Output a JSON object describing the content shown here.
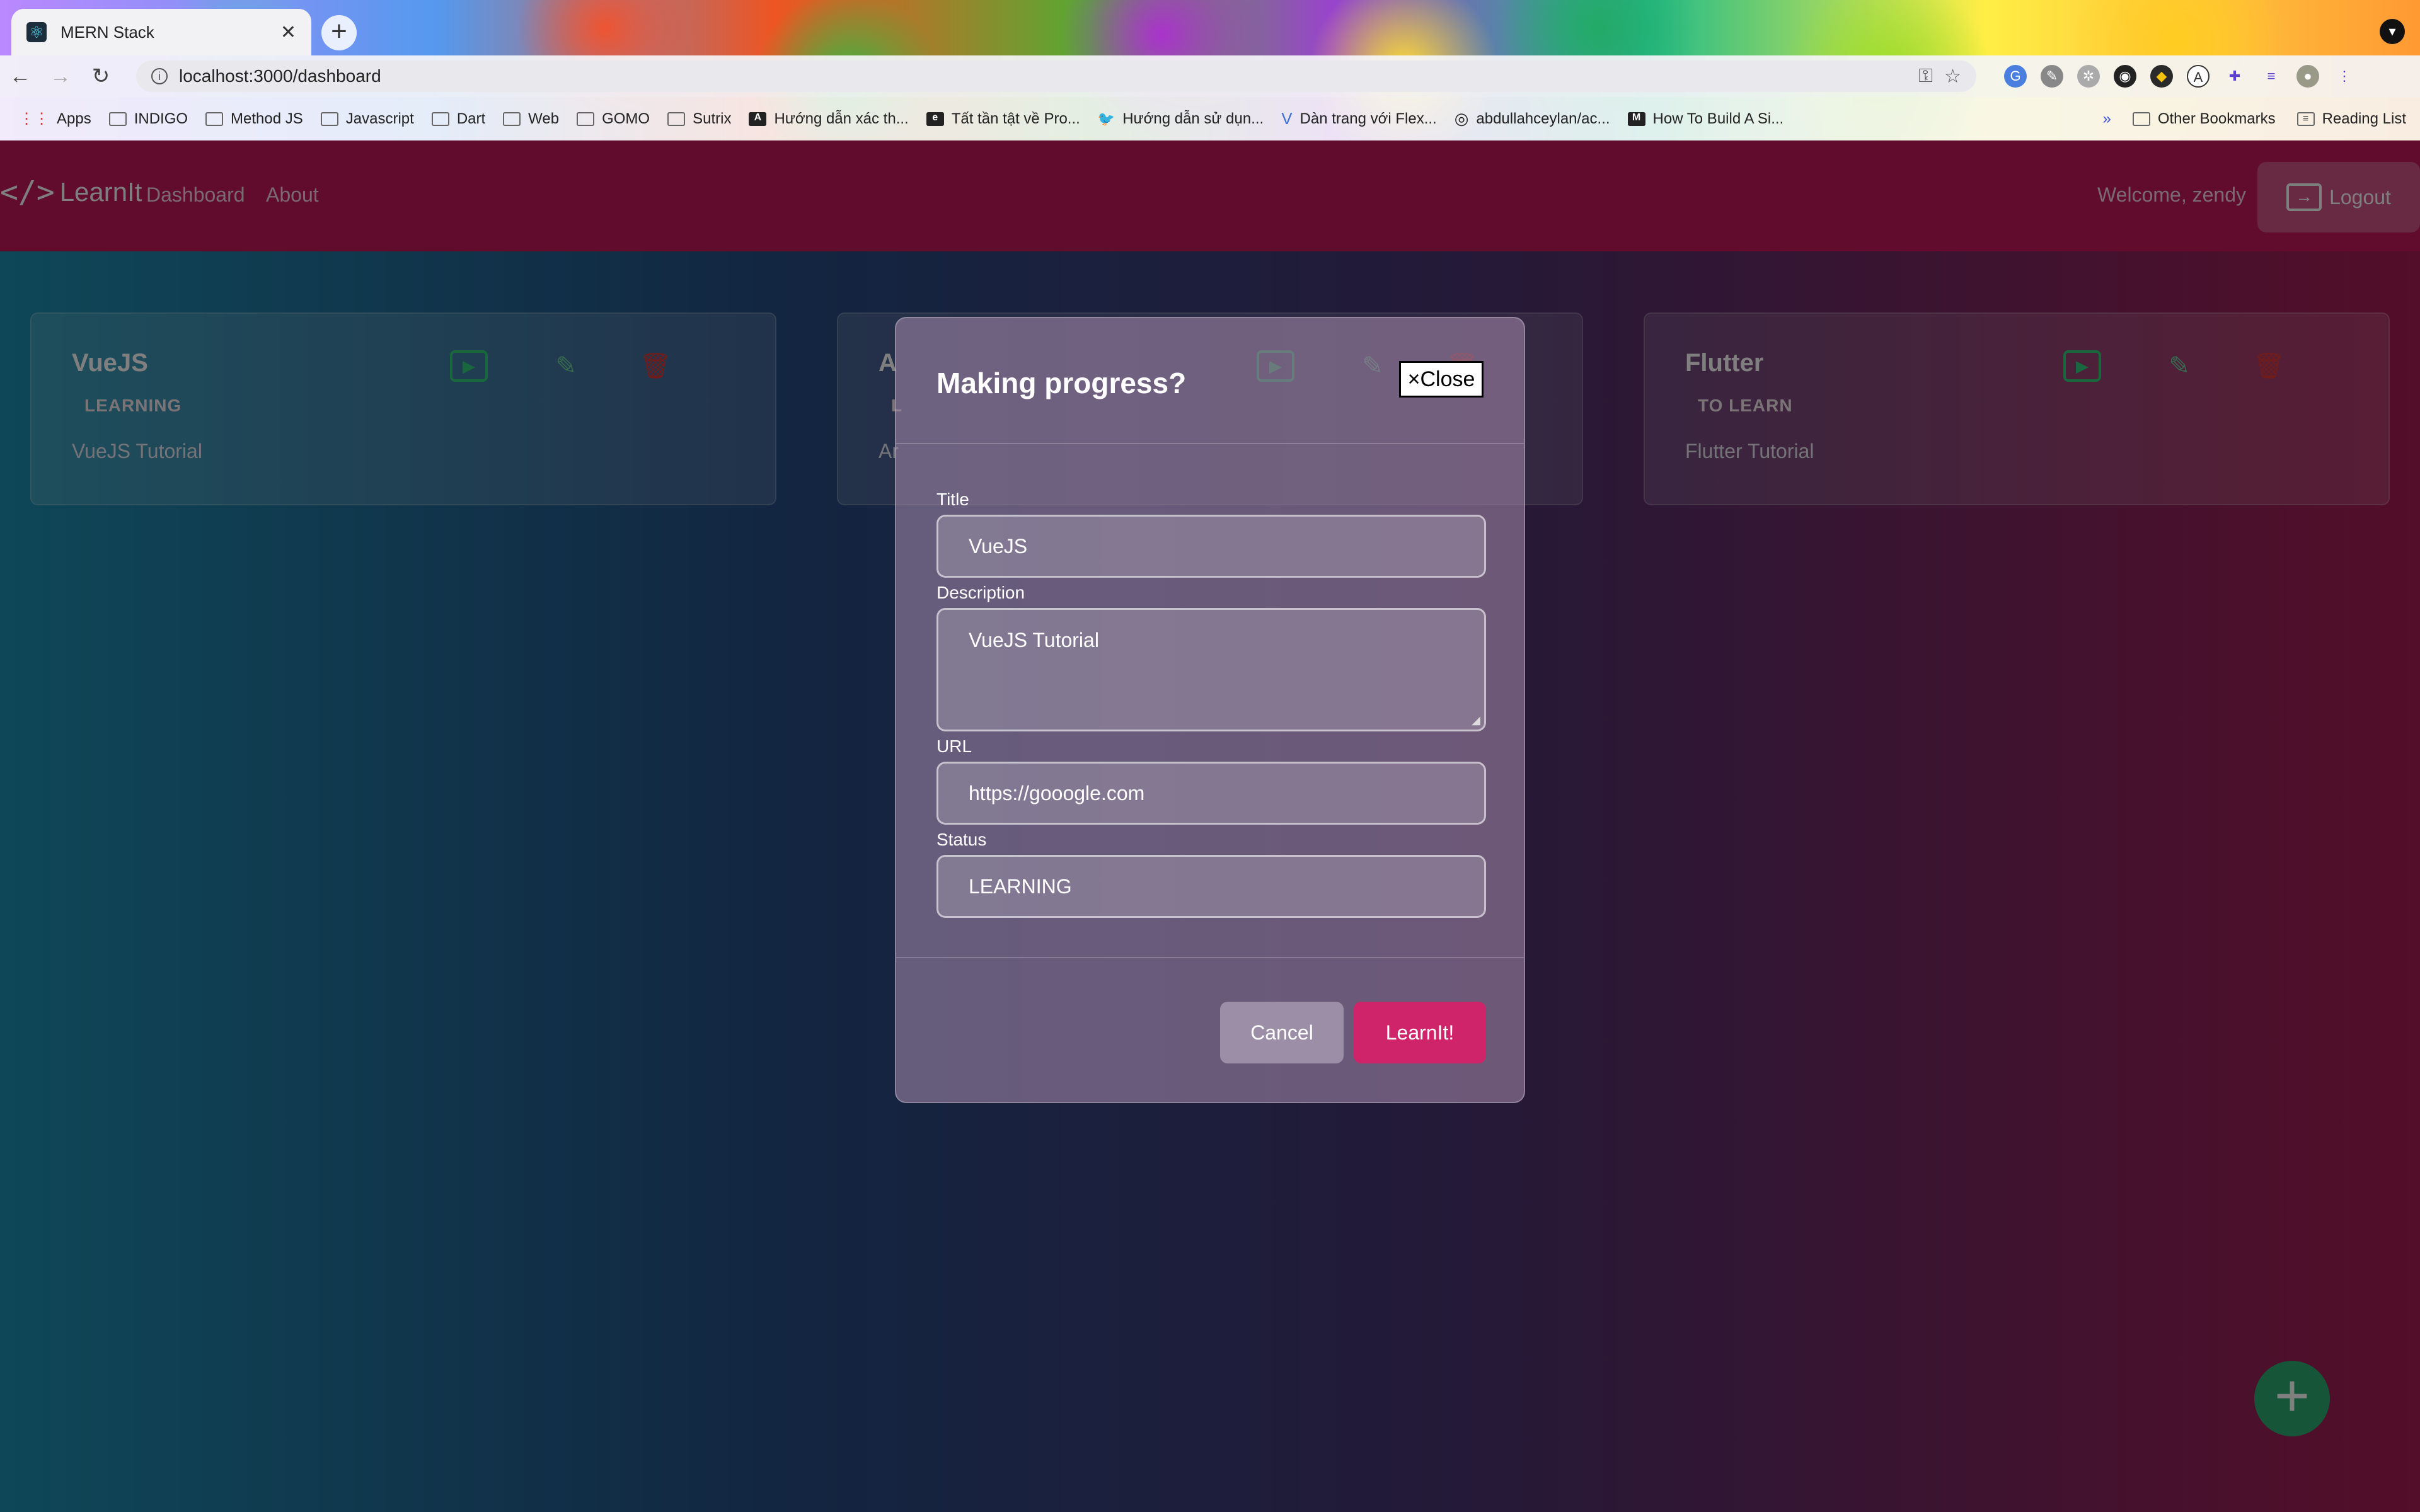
{
  "browser": {
    "tab_title": "MERN Stack",
    "url": "localhost:3000/dashboard",
    "bookmarks": [
      {
        "label": "Apps",
        "icon": "apps-grid-icon"
      },
      {
        "label": "INDIGO",
        "icon": "folder-icon"
      },
      {
        "label": "Method JS",
        "icon": "folder-icon"
      },
      {
        "label": "Javascript",
        "icon": "folder-icon"
      },
      {
        "label": "Dart",
        "icon": "folder-icon"
      },
      {
        "label": "Web",
        "icon": "folder-icon"
      },
      {
        "label": "GOMO",
        "icon": "folder-icon"
      },
      {
        "label": "Sutrix",
        "icon": "folder-icon"
      },
      {
        "label": "Hướng dẫn xác th...",
        "icon": "a-logo-icon"
      },
      {
        "label": "Tất tần tật về Pro...",
        "icon": "ef-logo-icon"
      },
      {
        "label": "Hướng dẫn sử dụn...",
        "icon": "bird-icon"
      },
      {
        "label": "Dàn trang với Flex...",
        "icon": "vue-icon"
      },
      {
        "label": "abdullahceylan/ac...",
        "icon": "github-icon"
      },
      {
        "label": "How To Build A Si...",
        "icon": "medium-icon"
      }
    ],
    "more_label": "»",
    "other_bookmarks": "Other Bookmarks",
    "reading_list": "Reading List"
  },
  "navbar": {
    "brand": "LearnIt",
    "links": [
      "Dashboard",
      "About"
    ],
    "welcome": "Welcome, zendy",
    "logout": "Logout"
  },
  "cards": [
    {
      "title": "VueJS",
      "status": "LEARNING",
      "description": "VueJS Tutorial"
    },
    {
      "title": "A",
      "status": "L",
      "description": "Ar"
    },
    {
      "title": "Flutter",
      "status": "TO LEARN",
      "description": "Flutter Tutorial"
    }
  ],
  "modal": {
    "title": "Making progress?",
    "close_label": "×Close",
    "fields": {
      "title_label": "Title",
      "title_value": "VueJS",
      "description_label": "Description",
      "description_value": "VueJS Tutorial",
      "url_label": "URL",
      "url_value": "https://gooogle.com",
      "status_label": "Status",
      "status_value": "LEARNING"
    },
    "cancel_label": "Cancel",
    "submit_label": "LearnIt!"
  },
  "fab_label": "+",
  "colors": {
    "navbar": "#c2185b",
    "accent": "#d0246a",
    "play": "#33d17a",
    "delete": "#e53935",
    "fab": "#2eaa71"
  }
}
